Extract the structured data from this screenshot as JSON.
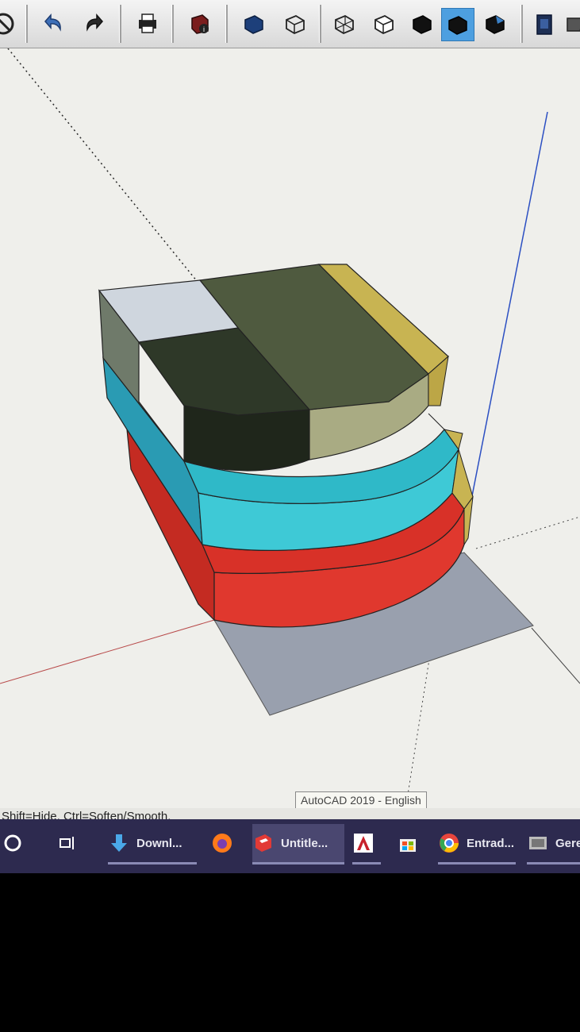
{
  "status_bar": {
    "hint": "Shift=Hide, Ctrl=Soften/Smooth."
  },
  "tooltip": {
    "text": "AutoCAD 2019 - English"
  },
  "toolbar": {
    "buttons": [
      {
        "icon": "no-entry-icon"
      },
      {
        "icon": "undo-icon"
      },
      {
        "icon": "redo-icon"
      },
      {
        "icon": "print-icon"
      },
      {
        "icon": "model-info-icon"
      },
      {
        "icon": "xray-style-icon"
      },
      {
        "icon": "back-edges-icon"
      },
      {
        "icon": "wireframe-icon"
      },
      {
        "icon": "hidden-line-icon"
      },
      {
        "icon": "shaded-icon"
      },
      {
        "icon": "shaded-textures-icon"
      },
      {
        "icon": "monochrome-icon"
      },
      {
        "icon": "section-plane-icon"
      }
    ],
    "active_button": "shaded-textures-icon"
  },
  "taskbar": {
    "items": [
      {
        "icon": "cortana-circle-icon",
        "label": ""
      },
      {
        "icon": "task-view-icon",
        "label": ""
      },
      {
        "icon": "download-arrow-icon",
        "label": "Downl..."
      },
      {
        "icon": "firefox-icon",
        "label": ""
      },
      {
        "icon": "sketchup-icon",
        "label": "Untitle..."
      },
      {
        "icon": "autocad-icon",
        "label": ""
      },
      {
        "icon": "store-bag-icon",
        "label": ""
      },
      {
        "icon": "chrome-icon",
        "label": "Entrad..."
      },
      {
        "icon": "app-window-icon",
        "label": "Gere"
      }
    ]
  },
  "colors": {
    "viewport_bg": "#efefeb",
    "ground_plane": "#99a0ae",
    "layer_red": "#e0382e",
    "layer_cyan": "#2fb9c8",
    "layer_dark": "#2e3828",
    "layer_olive": "#4f5a3f",
    "layer_sand": "#c8b452",
    "layer_light": "#cfd6de",
    "taskbar_bg": "#2d2a4f",
    "selection_blue": "#4d9fe0"
  }
}
